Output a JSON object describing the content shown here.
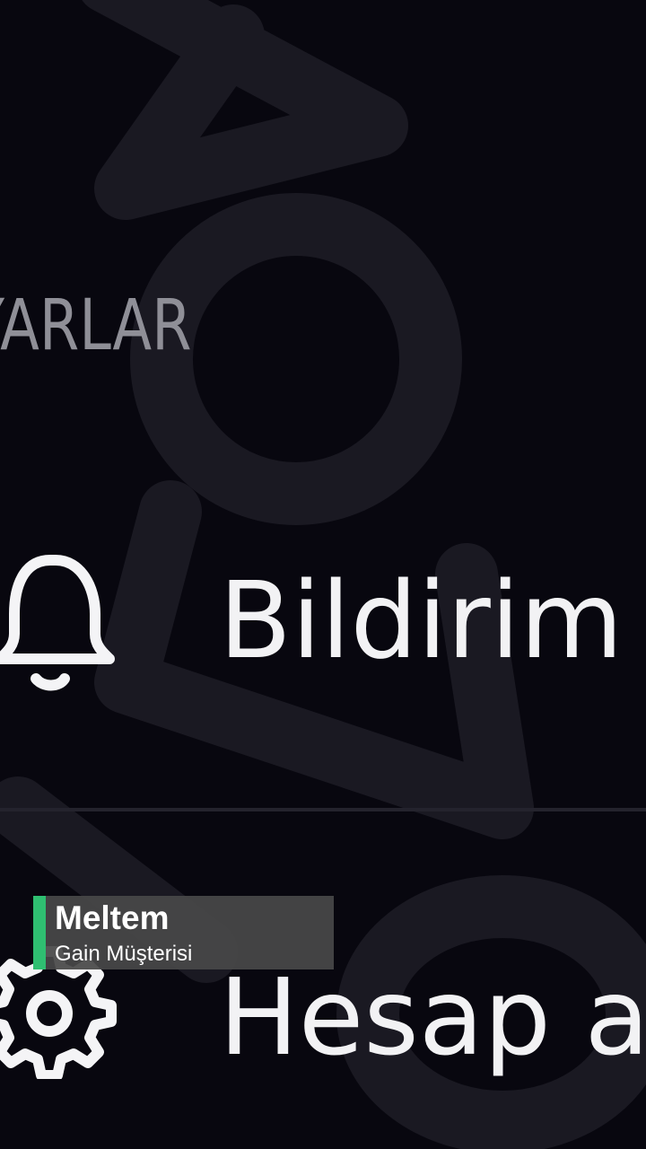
{
  "settings": {
    "section_header": "YARLAR",
    "items": [
      {
        "label": "Bildirim a",
        "icon": "bell-icon"
      },
      {
        "label": "Hesap a",
        "icon": "gear-icon"
      }
    ]
  },
  "overlay": {
    "name": "Meltem",
    "role": "Gain Müşterisi",
    "accent_color": "#2fbf71"
  },
  "colors": {
    "background": "#08070f",
    "text_primary": "#f2f2f4",
    "text_muted": "#8f8f97"
  }
}
